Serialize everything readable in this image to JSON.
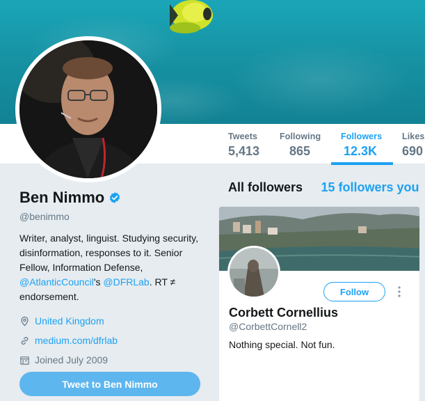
{
  "banner": {
    "image": "underwater-fish-photo"
  },
  "stats": [
    {
      "label": "Tweets",
      "value": "5,413",
      "active": false
    },
    {
      "label": "Following",
      "value": "865",
      "active": false
    },
    {
      "label": "Followers",
      "value": "12.3K",
      "active": true
    },
    {
      "label": "Likes",
      "value": "690",
      "active": false
    }
  ],
  "profile": {
    "name": "Ben Nimmo",
    "verified": true,
    "handle": "@benimmo",
    "bio_line": "Writer, analyst, linguist. Studying security, disinformation, responses to it. Senior Fellow, Information Defense,",
    "bio_mention1": "@AtlanticCouncil",
    "bio_sep": "'s ",
    "bio_mention2": "@DFRLab",
    "bio_tail": ". RT ≠ endorsement.",
    "location": "United Kingdom",
    "website": "medium.com/dfrlab",
    "joined": "Joined July 2009",
    "tweet_button": "Tweet to Ben Nimmo"
  },
  "followers_panel": {
    "all_label": "All followers",
    "you_know_label": "15 followers you"
  },
  "follower_card": {
    "name": "Corbett Cornellius",
    "handle": "@CorbettCornell2",
    "bio": "Nothing special. Not fun.",
    "follow_label": "Follow"
  },
  "colors": {
    "accent": "#1da1f2",
    "tweet_button": "#5eb6ee",
    "background": "#e6ecf0",
    "muted": "#657786"
  },
  "icons": [
    "verified-badge-icon",
    "location-pin-icon",
    "link-icon",
    "calendar-icon",
    "more-dots-icon"
  ]
}
